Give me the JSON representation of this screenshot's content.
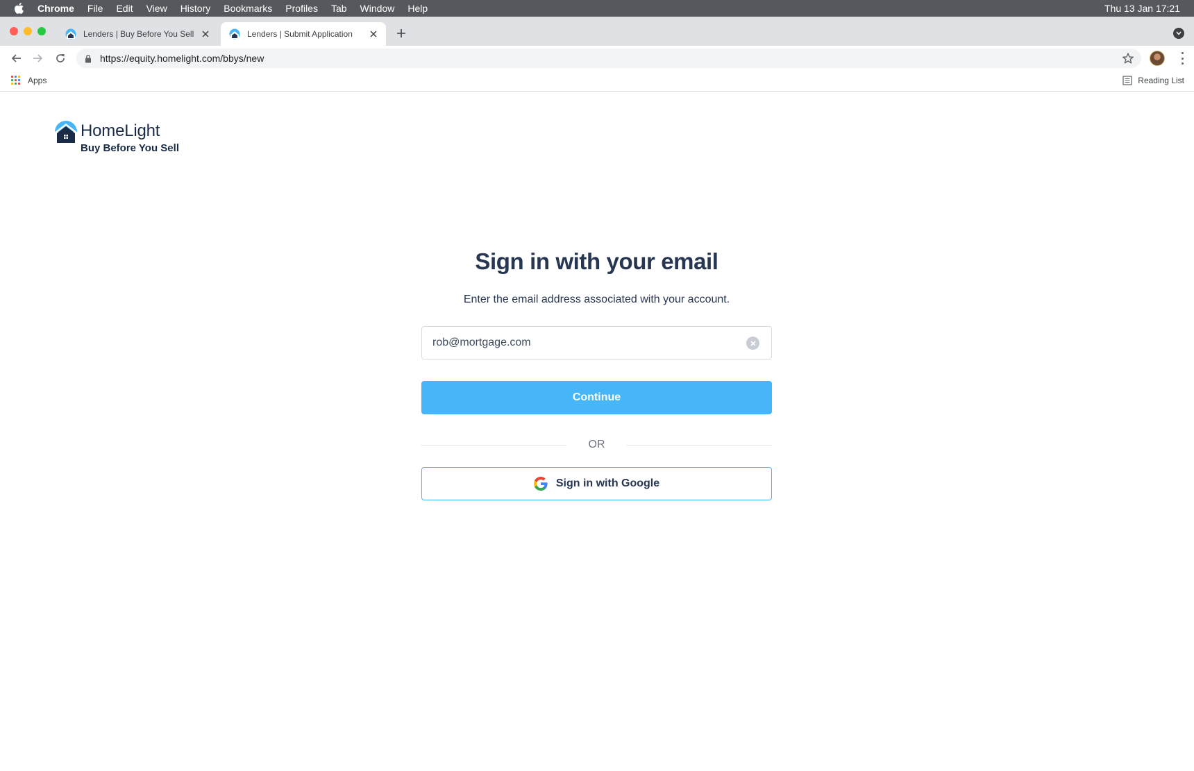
{
  "menubar": {
    "app_name": "Chrome",
    "items": [
      "File",
      "Edit",
      "View",
      "History",
      "Bookmarks",
      "Profiles",
      "Tab",
      "Window",
      "Help"
    ],
    "clock": "Thu 13 Jan  17:21"
  },
  "tabs": [
    {
      "title": "Lenders | Buy Before You Sell",
      "active": false
    },
    {
      "title": "Lenders | Submit Application",
      "active": true
    }
  ],
  "toolbar": {
    "url": "https://equity.homelight.com/bbys/new"
  },
  "bookmarks_bar": {
    "apps_label": "Apps",
    "reading_list_label": "Reading List"
  },
  "page": {
    "logo": {
      "name": "HomeLight",
      "subtitle": "Buy Before You Sell"
    },
    "heading": "Sign in with your email",
    "subtitle": "Enter the email address associated with your account.",
    "email_value": "rob@mortgage.com",
    "continue_label": "Continue",
    "divider_label": "OR",
    "google_label": "Sign in with Google"
  },
  "colors": {
    "accent": "#46b6f9",
    "heading": "#273651",
    "menubar": "#55585c"
  }
}
